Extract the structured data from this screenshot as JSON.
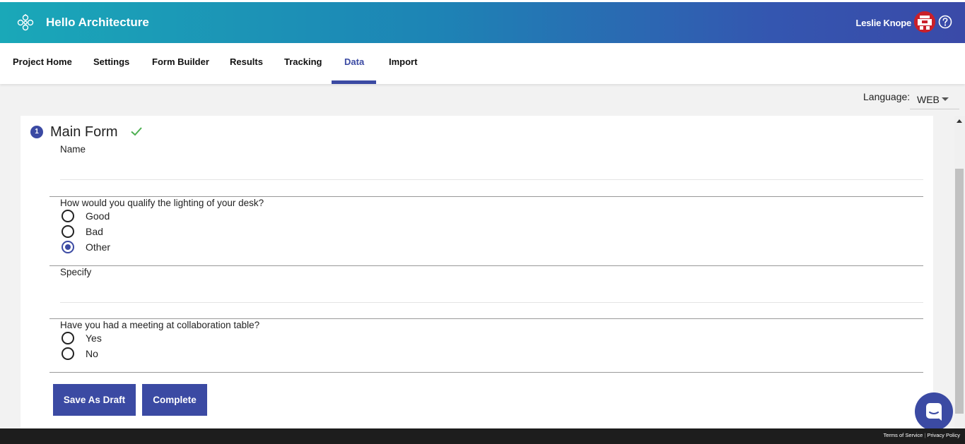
{
  "header": {
    "app_title": "Hello Architecture",
    "user_name": "Leslie Knope",
    "colors": {
      "gradient_start": "#1aa8b8",
      "gradient_end": "#3a4aa8"
    },
    "icons": {
      "logo": "flower-logo-icon",
      "help": "question-circle-icon"
    }
  },
  "tabs": [
    {
      "label": "Project Home",
      "active": false
    },
    {
      "label": "Settings",
      "active": false
    },
    {
      "label": "Form Builder",
      "active": false
    },
    {
      "label": "Results",
      "active": false
    },
    {
      "label": "Tracking",
      "active": false
    },
    {
      "label": "Data",
      "active": true
    },
    {
      "label": "Import",
      "active": false
    }
  ],
  "language": {
    "label": "Language:",
    "selected": "WEB"
  },
  "form": {
    "step_number": "1",
    "title": "Main Form",
    "status_icon": "check-icon",
    "name_label": "Name",
    "name_value": "",
    "q1": {
      "label": "How would you qualify the lighting of your desk?",
      "options": [
        "Good",
        "Bad",
        "Other"
      ],
      "selected": "Other"
    },
    "specify_label": "Specify",
    "specify_value": "",
    "q2": {
      "label": "Have you had a meeting at collaboration table?",
      "options": [
        "Yes",
        "No"
      ],
      "selected": null
    }
  },
  "buttons": {
    "save_draft": "Save As Draft",
    "complete": "Complete"
  },
  "footer": {
    "terms": "Terms of Service",
    "privacy": "Privacy Policy"
  },
  "accent_color": "#3b4aa3"
}
